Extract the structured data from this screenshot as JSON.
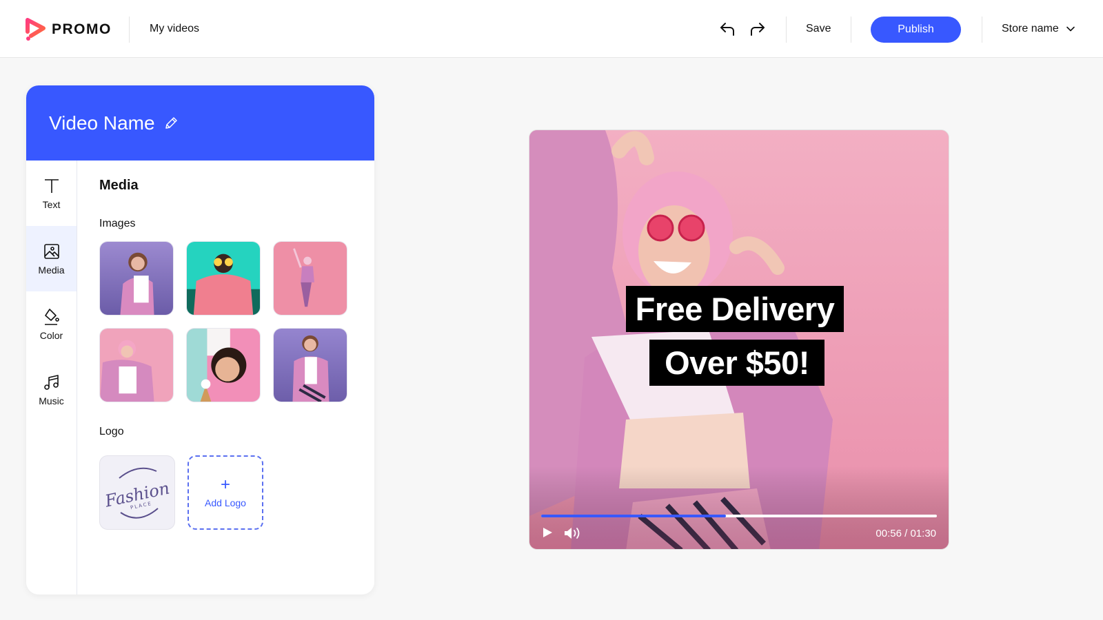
{
  "app": {
    "brand": "PROMO",
    "brand_colors": {
      "primary": "#3858ff",
      "logo_gradient_start": "#ff3d7f",
      "logo_gradient_end": "#ff6a3d"
    }
  },
  "header": {
    "nav_link": "My videos",
    "undo_icon": "undo-icon",
    "redo_icon": "redo-icon",
    "save_label": "Save",
    "publish_label": "Publish",
    "store_selector": {
      "label": "Store name",
      "icon": "chevron-down-icon"
    }
  },
  "panel": {
    "title": "Video Name",
    "edit_icon": "pencil-icon",
    "rail": [
      {
        "label": "Text",
        "icon": "text-icon",
        "active": false
      },
      {
        "label": "Media",
        "icon": "image-icon",
        "active": true
      },
      {
        "label": "Color",
        "icon": "paint-bucket-icon",
        "active": false
      },
      {
        "label": "Music",
        "icon": "music-note-icon",
        "active": false
      }
    ],
    "content": {
      "title": "Media",
      "images_label": "Images",
      "images": [
        {
          "description": "woman in pink fur coat, purple background"
        },
        {
          "description": "woman holding lemon slices over eyes, teal background"
        },
        {
          "description": "woman dancing, pink background"
        },
        {
          "description": "woman with pink hair laughing, pink background"
        },
        {
          "description": "woman with ice cream cone, teal and pink background"
        },
        {
          "description": "woman in pink fur coat, purple background"
        }
      ],
      "logo_label": "Logo",
      "logo": {
        "text": "Fashion",
        "subtext": "PLACE"
      },
      "add_logo_label": "Add Logo",
      "add_logo_icon": "plus-icon"
    }
  },
  "video": {
    "overlay_line_1": "Free Delivery",
    "overlay_line_2": "Over $50!",
    "progress": 0.4667,
    "current_time": "00:56",
    "duration": "01:30",
    "time_display": "00:56 / 01:30",
    "play_icon": "play-icon",
    "volume_icon": "volume-icon"
  }
}
